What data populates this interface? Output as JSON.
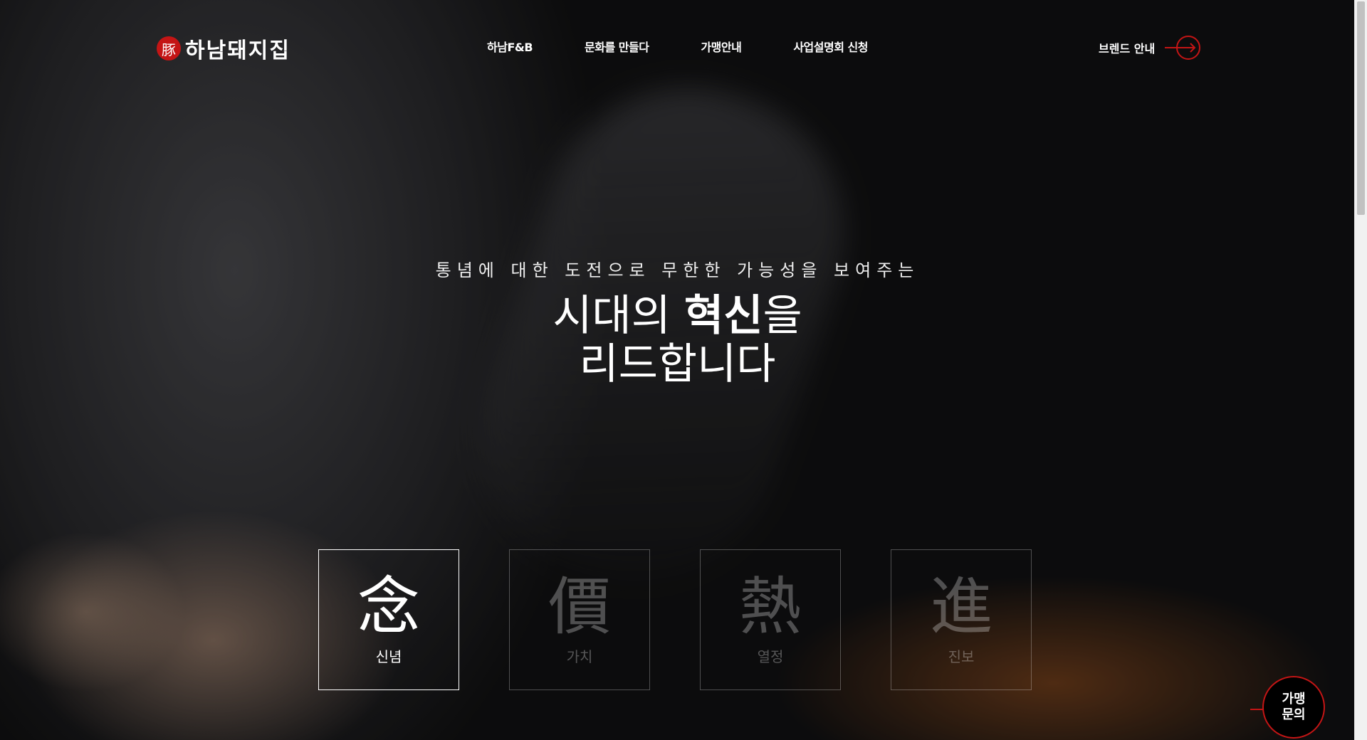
{
  "header": {
    "logo_seal": "豚",
    "logo_text": "하남돼지집",
    "nav": [
      "하남F&B",
      "문화를 만들다",
      "가맹안내",
      "사업설명회 신청"
    ],
    "brand_link": "브렌드 안내"
  },
  "hero": {
    "subtitle": "통념에 대한 도전으로 무한한 가능성을 보여주는",
    "headline_part1": "시대의 ",
    "headline_bold": "혁신",
    "headline_part2": "을",
    "headline_line2": "리드합니다"
  },
  "values": [
    {
      "hanja": "念",
      "meaning": "신념",
      "active": true
    },
    {
      "hanja": "價",
      "meaning": "가치",
      "active": false
    },
    {
      "hanja": "熱",
      "meaning": "열정",
      "active": false
    },
    {
      "hanja": "進",
      "meaning": "진보",
      "active": false
    }
  ],
  "fab": {
    "line1": "가맹",
    "line2": "문의"
  },
  "colors": {
    "accent": "#c41515"
  }
}
